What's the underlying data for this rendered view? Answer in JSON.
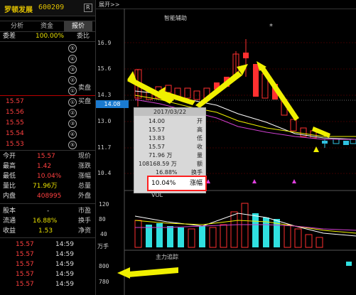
{
  "header": {
    "code": "600209",
    "name": "罗顿发展",
    "badge": "R"
  },
  "tabs": [
    {
      "label": "分析"
    },
    {
      "label": "资金"
    },
    {
      "label": "报价"
    }
  ],
  "order_book": {
    "ratio_label": "委比",
    "ratio_value": "100.00%",
    "ratio_suffix": "委差",
    "sells": [
      {
        "label": "卖盘⑤",
        "n": "⑤",
        "price": "",
        "vol": ""
      },
      {
        "label": "卖盘④",
        "n": "④",
        "price": "",
        "vol": ""
      },
      {
        "label": "卖盘③",
        "n": "③",
        "price": "",
        "vol": ""
      },
      {
        "label": "卖盘②",
        "n": "②",
        "price": "",
        "vol": ""
      },
      {
        "label": "卖盘①",
        "n": "①",
        "price": "",
        "vol": ""
      }
    ],
    "buys": [
      {
        "label": "买盘①",
        "n": "①",
        "price": "15.57"
      },
      {
        "label": "买盘②",
        "n": "②",
        "price": "15.56"
      },
      {
        "label": "买盘③",
        "n": "③",
        "price": "15.55"
      },
      {
        "label": "买盘④",
        "n": "④",
        "price": "15.54"
      },
      {
        "label": "买盘⑤",
        "n": "⑤",
        "price": "15.53"
      }
    ],
    "sell_label": "卖盘",
    "buy_label": "买盘"
  },
  "quote": [
    {
      "label": "现价",
      "value": "15.57",
      "label2": "今开",
      "color": "red"
    },
    {
      "label": "涨跌",
      "value": "1.42",
      "label2": "最高",
      "color": "red"
    },
    {
      "label": "涨幅",
      "value": "10.04%",
      "label2": "最低",
      "color": "red"
    },
    {
      "label": "总量",
      "value": "71.96万",
      "label2": "量比",
      "color": "yellow"
    },
    {
      "label": "外盘",
      "value": "408995",
      "label2": "内盘",
      "color": "red"
    },
    {
      "label": "市盈",
      "value": "-",
      "label2": "股本",
      "color": "white"
    },
    {
      "label": "换手",
      "value": "16.88%",
      "label2": "流通",
      "color": "yellow"
    },
    {
      "label": "净资",
      "value": "1.53",
      "label2": "收益",
      "color": "yellow"
    }
  ],
  "ticks": [
    {
      "time": "14:59",
      "price": "15.57"
    },
    {
      "time": "14:59",
      "price": "15.57"
    },
    {
      "time": "14:59",
      "price": "15.57"
    },
    {
      "time": "14:59",
      "price": "15.57"
    },
    {
      "time": "14:59",
      "price": "15.57"
    },
    {
      "time": "14:59",
      "price": "15.57"
    }
  ],
  "chart": {
    "topbar_label": "展开>>",
    "main_title": "智能辅助",
    "price_tag": "14.08",
    "y_ticks": [
      "16.9",
      "15.6",
      "14.3",
      "13.0",
      "11.7",
      "10.4"
    ],
    "vol_title": "VOL",
    "vol_unit": "万手",
    "vol_ticks": [
      "120",
      "80",
      "40"
    ],
    "flow_title": "主力追踪",
    "flow_ticks": [
      "800",
      "780"
    ]
  },
  "tooltip": {
    "date": "2017/03/22",
    "rows": [
      {
        "label": "开",
        "value": "14.00"
      },
      {
        "label": "高",
        "value": "15.57"
      },
      {
        "label": "低",
        "value": "13.83"
      },
      {
        "label": "收",
        "value": "15.57"
      },
      {
        "label": "量",
        "value": "71.96 万"
      },
      {
        "label": "额",
        "value": "108168.59 万"
      },
      {
        "label": "换手",
        "value": "16.88%"
      }
    ],
    "highlight_label": "涨幅",
    "highlight_value": "10.04%"
  },
  "colors": {
    "up": "#ff3030",
    "down": "#30c0e0",
    "arrow": "#f0f000",
    "ma1": "#ffffff",
    "ma2": "#f0f000",
    "ma3": "#d040d0"
  }
}
